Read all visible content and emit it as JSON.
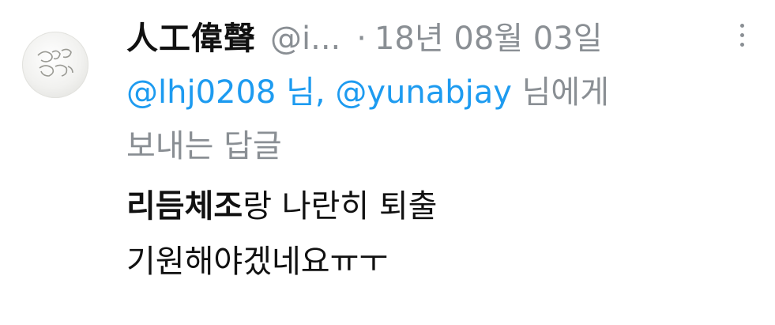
{
  "tweet": {
    "author_name": "人工偉聲",
    "author_handle": "@i...",
    "separator": "·",
    "date": "18년 08월 03일",
    "reply_to": {
      "mention_1": "@lhj0208 님",
      "comma": ", ",
      "mention_2": "@yunabjay",
      "suffix_line1": " 님에게",
      "line2": "보내는 답글"
    },
    "text": {
      "line1_bold": "리듬체조",
      "line1_rest": "랑 나란히 퇴출",
      "line2": "기원해야겠네요ㅠㅜ"
    }
  },
  "colors": {
    "mention": "#1d9bf0",
    "muted": "#8a8f94",
    "text": "#111111"
  },
  "icons": {
    "avatar": "avatar",
    "more": "more-vertical-icon"
  }
}
